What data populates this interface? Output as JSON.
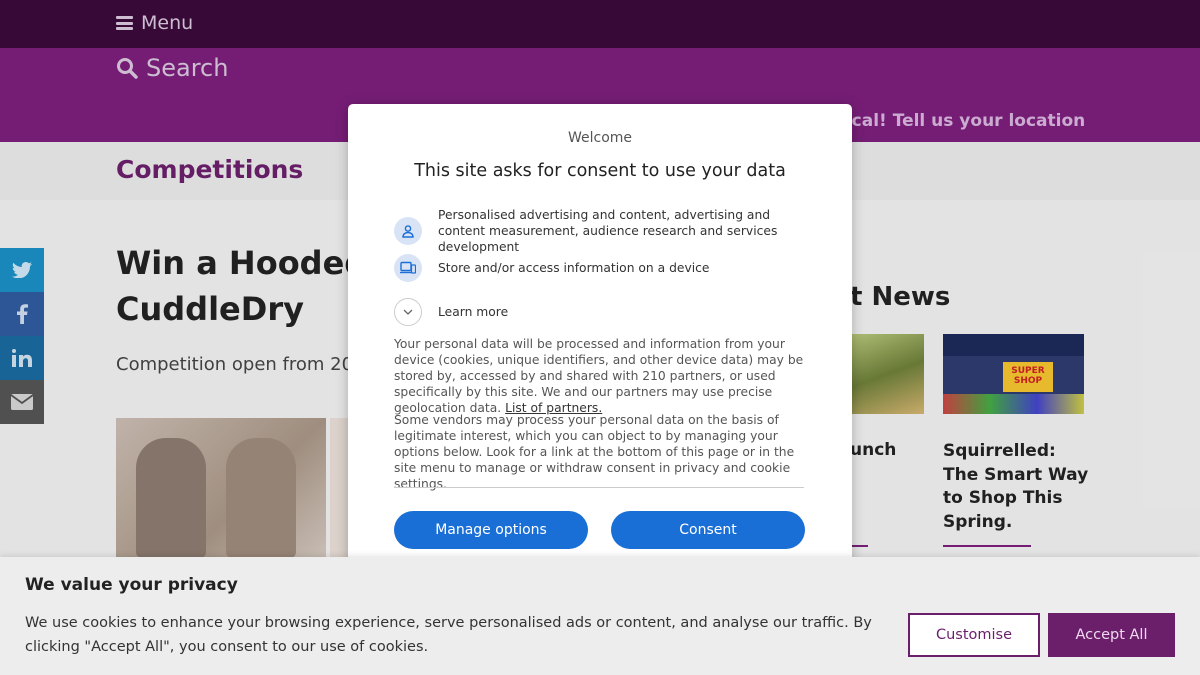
{
  "header": {
    "menu_label": "Menu",
    "search_label": "Search",
    "local_link": "ocal! Tell us your location"
  },
  "section": {
    "title": "Competitions"
  },
  "share": {
    "icons": [
      "twitter-icon",
      "facebook-icon",
      "linkedin-icon",
      "email-icon"
    ]
  },
  "article": {
    "title_line1": "Win a Hooded",
    "title_line2": "CuddleDry",
    "open_text": "Competition open from 20"
  },
  "latest_news": {
    "heading": "t News",
    "items": [
      {
        "caption": "unch"
      },
      {
        "caption": "Squirrelled: The Smart Way to Shop This Spring."
      }
    ]
  },
  "consent_modal": {
    "welcome": "Welcome",
    "title": "This site asks for consent to use your data",
    "purposes": [
      {
        "icon": "person-icon",
        "label": "Personalised advertising and content, advertising and content measurement, audience research and services development"
      },
      {
        "icon": "device-icon",
        "label": "Store and/or access information on a device"
      }
    ],
    "learn_more": "Learn more",
    "body1": "Your personal data will be processed and information from your device (cookies, unique identifiers, and other device data) may be stored by, accessed by and shared with 210 partners, or used specifically by this site. We and our partners may use precise geolocation data.",
    "partners_link": "List of partners.",
    "body2": "Some vendors may process your personal data on the basis of legitimate interest, which you can object to by managing your options below. Look for a link at the bottom of this page or in the site menu to manage or withdraw consent in privacy and cookie settings.",
    "manage_label": "Manage options",
    "consent_label": "Consent"
  },
  "cookie_bar": {
    "title": "We value your privacy",
    "text": "We use cookies to enhance your browsing experience, serve personalised ads or content, and analyse our traffic. By clicking \"Accept All\", you consent to our use of cookies.",
    "customise_label": "Customise",
    "accept_label": "Accept All"
  },
  "colors": {
    "header_dark": "#3a0a3a",
    "header_purple": "#7c1f7c",
    "brand": "#6b1f6b",
    "consent_blue": "#1a6fd6"
  }
}
